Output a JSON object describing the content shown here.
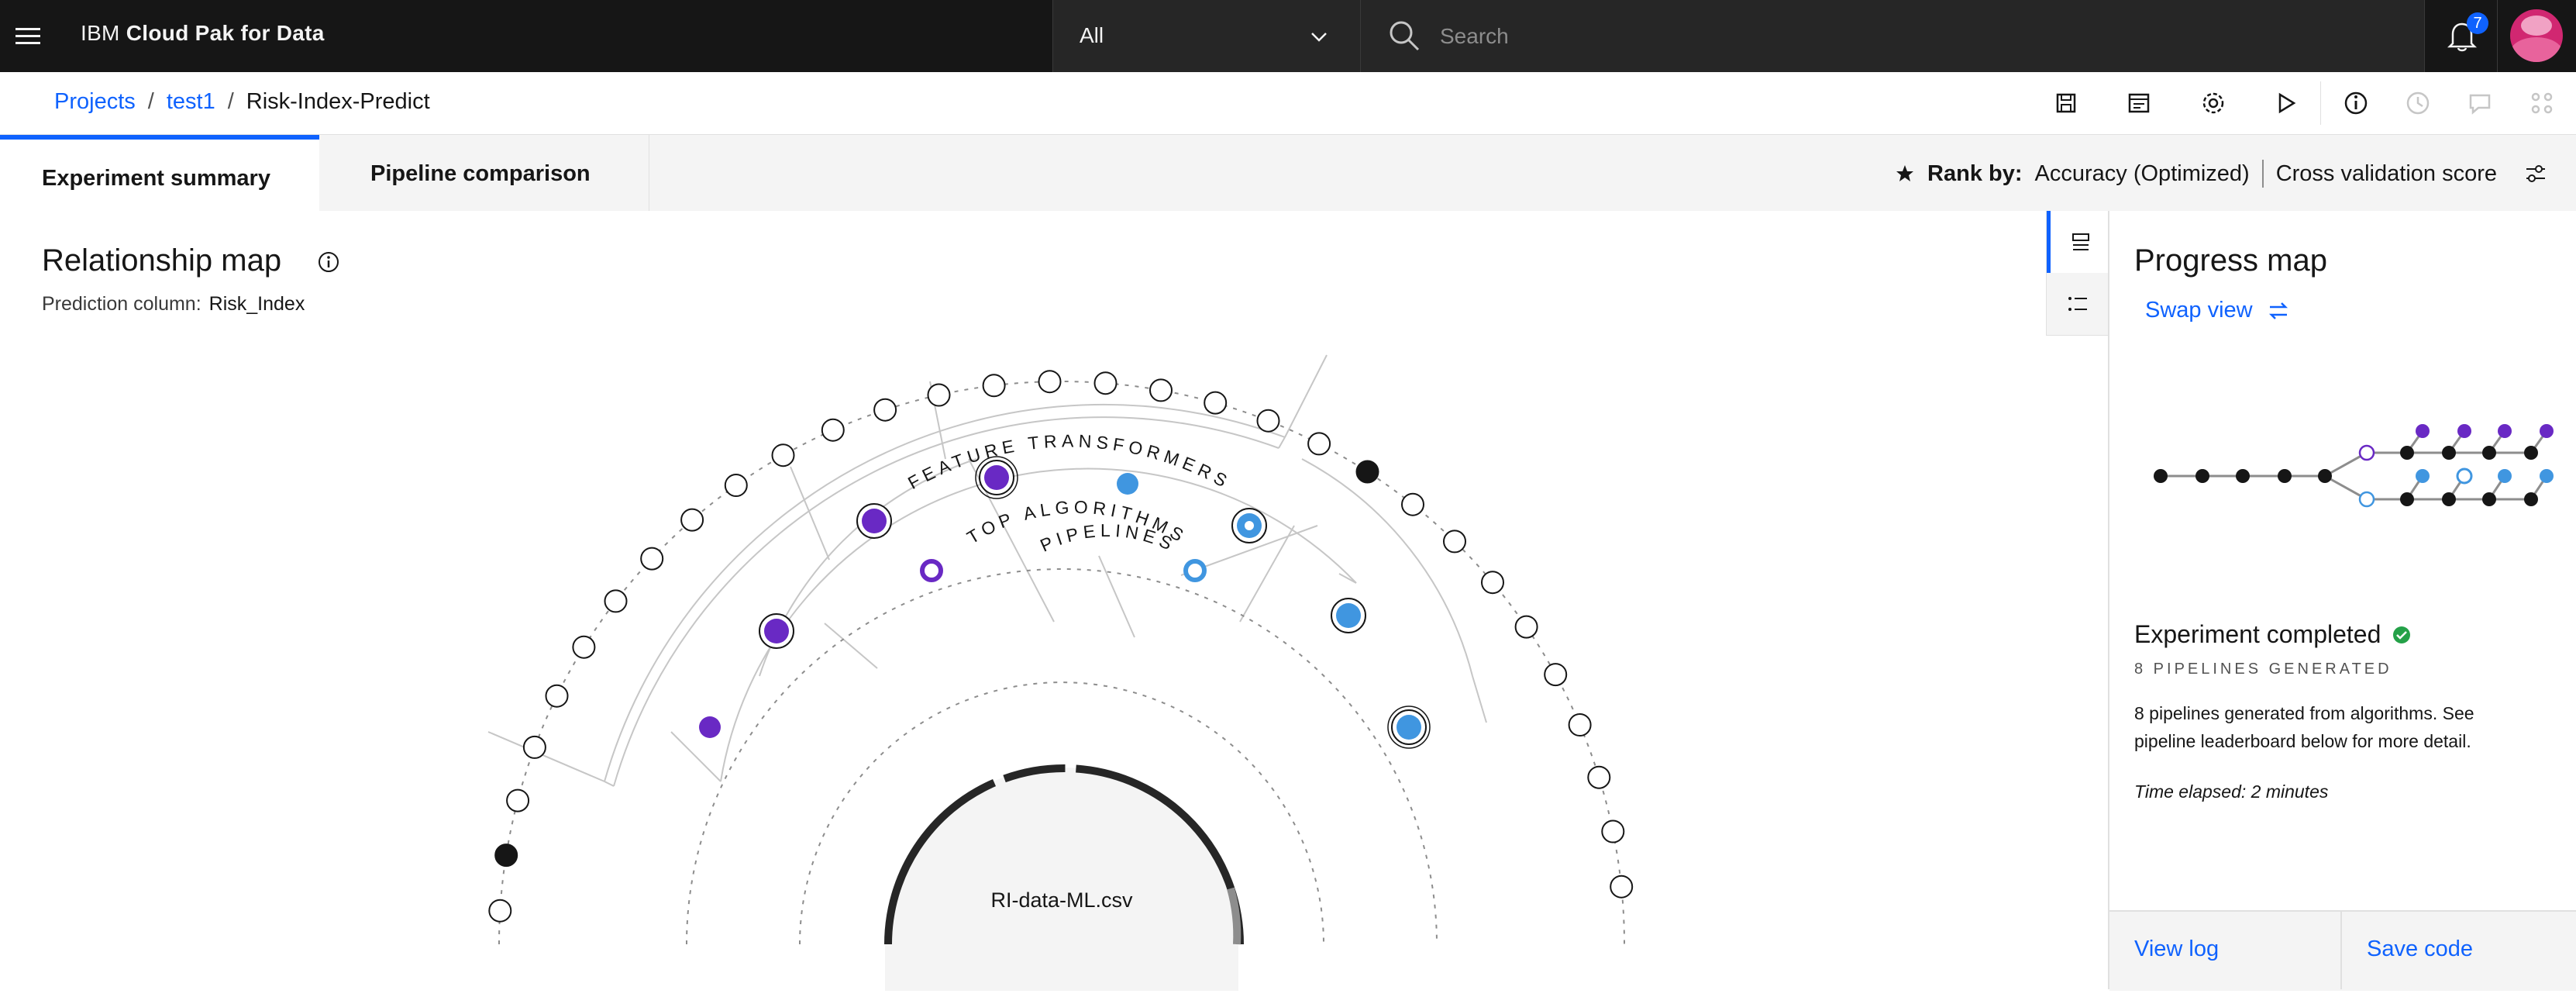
{
  "header": {
    "brand_prefix": "IBM",
    "brand_name": "Cloud Pak for Data",
    "scope_value": "All",
    "search_placeholder": "Search",
    "notification_count": "7"
  },
  "breadcrumb": {
    "items": [
      "Projects",
      "test1"
    ],
    "separator": "/",
    "current": "Risk-Index-Predict"
  },
  "tabs": [
    {
      "label": "Experiment summary"
    },
    {
      "label": "Pipeline comparison"
    }
  ],
  "rank": {
    "label": "Rank by:",
    "metric": "Accuracy (Optimized)",
    "score": "Cross validation score"
  },
  "relationship_map": {
    "title": "Relationship map",
    "prediction_label": "Prediction column:",
    "prediction_value": "Risk_Index",
    "ring_feature": "FEATURE TRANSFORMERS",
    "ring_pipelines": "PIPELINES",
    "ring_algorithms": "TOP ALGORITHMS",
    "dataset": "RI-data-ML.csv"
  },
  "progress_map": {
    "title": "Progress map",
    "swap_label": "Swap view",
    "status": "Experiment completed",
    "generated": "8 PIPELINES GENERATED",
    "description": "8 pipelines generated from algorithms. See pipeline leaderboard below for more detail.",
    "elapsed": "Time elapsed: 2 minutes",
    "view_log": "View log",
    "save_code": "Save code"
  },
  "colors": {
    "purple": "#6929c4",
    "blue": "#4096e0",
    "accent": "#0f62fe",
    "success": "#24a148"
  }
}
